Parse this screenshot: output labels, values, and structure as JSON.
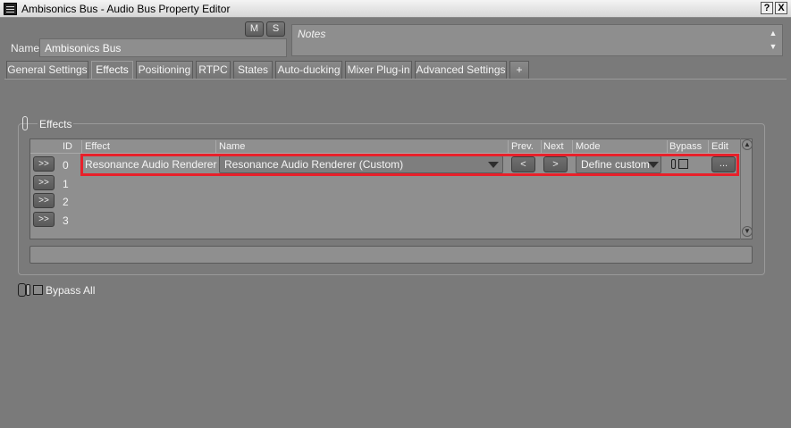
{
  "window": {
    "title": "Ambisonics Bus - Audio Bus Property Editor",
    "help_label": "?",
    "close_label": "X"
  },
  "header": {
    "mute_label": "M",
    "solo_label": "S",
    "name_label": "Name",
    "name_value": "Ambisonics Bus",
    "notes_placeholder": "Notes"
  },
  "tabs": [
    {
      "label": "General Settings"
    },
    {
      "label": "Effects",
      "active": true
    },
    {
      "label": "Positioning"
    },
    {
      "label": "RTPC"
    },
    {
      "label": "States"
    },
    {
      "label": "Auto-ducking"
    },
    {
      "label": "Mixer Plug-in"
    },
    {
      "label": "Advanced Settings"
    },
    {
      "label": "+"
    }
  ],
  "effects": {
    "group_label": "Effects",
    "columns": {
      "id": "ID",
      "effect": "Effect",
      "name": "Name",
      "prev": "Prev.",
      "next": "Next",
      "mode": "Mode",
      "bypass": "Bypass",
      "edit": "Edit"
    },
    "row_button_label": ">>",
    "rows": [
      {
        "id": "0",
        "effect": "Resonance Audio Renderer",
        "name": "Resonance Audio Renderer (Custom)",
        "mode": "Define custom"
      },
      {
        "id": "1"
      },
      {
        "id": "2"
      },
      {
        "id": "3"
      }
    ],
    "prev_label": "<",
    "next_label": ">",
    "edit_label": "...",
    "bypass_all_label": "Bypass All"
  },
  "colors": {
    "highlight": "#e8202a",
    "background": "#7a7a7a"
  }
}
